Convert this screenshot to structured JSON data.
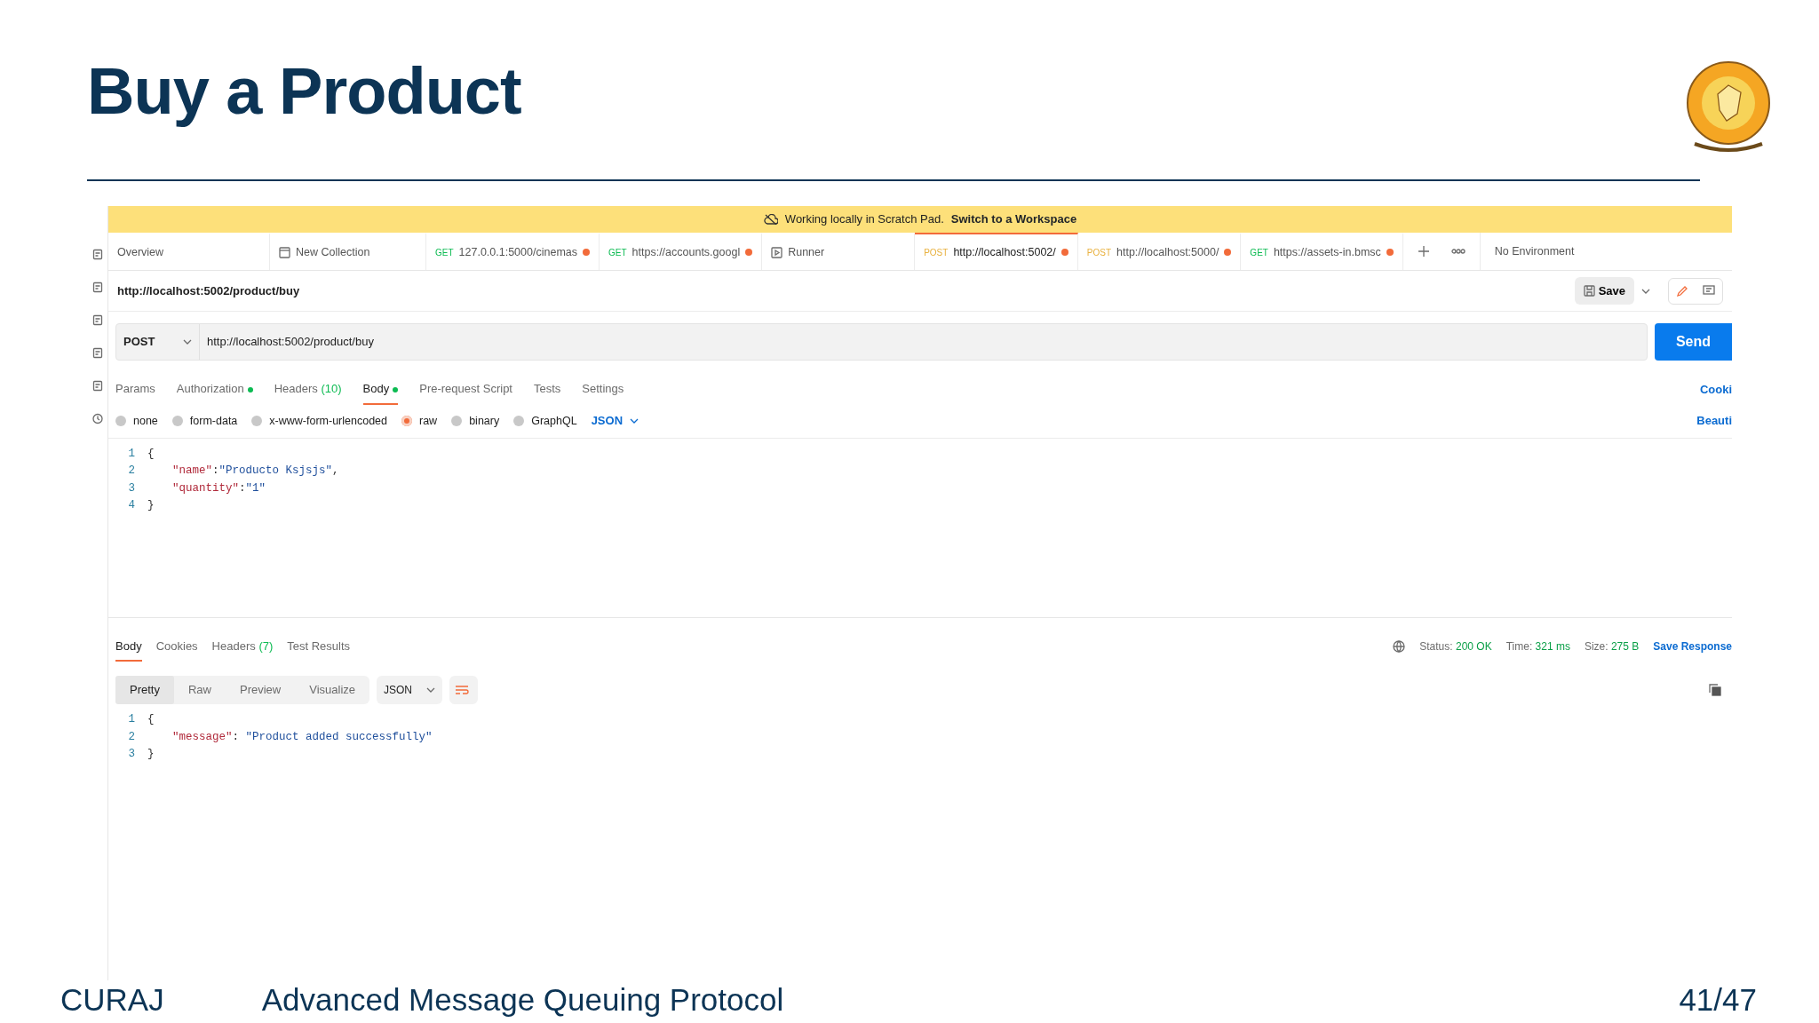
{
  "slide": {
    "title": "Buy a Product"
  },
  "banner": {
    "text": "Working locally in Scratch Pad.",
    "link": "Switch to a Workspace"
  },
  "tabs": [
    {
      "kind": "overview",
      "label": "Overview",
      "selected": false,
      "unsaved": false
    },
    {
      "kind": "collection",
      "label": "New Collection",
      "selected": false,
      "unsaved": false
    },
    {
      "kind": "request",
      "method": "GET",
      "label": "127.0.0.1:5000/cinemas",
      "selected": false,
      "unsaved": true
    },
    {
      "kind": "request",
      "method": "GET",
      "label": "https://accounts.googl",
      "selected": false,
      "unsaved": true
    },
    {
      "kind": "runner",
      "label": "Runner",
      "selected": false,
      "unsaved": false
    },
    {
      "kind": "request",
      "method": "POST",
      "label": "http://localhost:5002/",
      "selected": true,
      "unsaved": true
    },
    {
      "kind": "request",
      "method": "POST",
      "label": "http://localhost:5000/",
      "selected": false,
      "unsaved": true
    },
    {
      "kind": "request",
      "method": "GET",
      "label": "https://assets-in.bmsc",
      "selected": false,
      "unsaved": true
    }
  ],
  "environment": "No Environment",
  "request": {
    "name": "http://localhost:5002/product/buy",
    "save": "Save",
    "method": "POST",
    "url": "http://localhost:5002/product/buy",
    "send": "Send",
    "tabs": [
      {
        "label": "Params",
        "dot": false,
        "selected": false
      },
      {
        "label": "Authorization",
        "dot": true,
        "selected": false
      },
      {
        "label": "Headers",
        "count": "(10)",
        "dot": false,
        "selected": false
      },
      {
        "label": "Body",
        "dot": true,
        "selected": true
      },
      {
        "label": "Pre-request Script",
        "dot": false,
        "selected": false
      },
      {
        "label": "Tests",
        "dot": false,
        "selected": false
      },
      {
        "label": "Settings",
        "dot": false,
        "selected": false
      }
    ],
    "cookies_link": "Cooki",
    "body_types": [
      {
        "label": "none",
        "selected": false
      },
      {
        "label": "form-data",
        "selected": false
      },
      {
        "label": "x-www-form-urlencoded",
        "selected": false
      },
      {
        "label": "raw",
        "selected": true
      },
      {
        "label": "binary",
        "selected": false
      },
      {
        "label": "GraphQL",
        "selected": false
      }
    ],
    "format": "JSON",
    "beautify_link": "Beauti",
    "body_lines": [
      {
        "number": "1",
        "indent": false,
        "tokens": [
          {
            "kind": "punct",
            "text": "{"
          }
        ]
      },
      {
        "number": "2",
        "indent": true,
        "tokens": [
          {
            "kind": "key",
            "text": "\"name\""
          },
          {
            "kind": "punct",
            "text": ":"
          },
          {
            "kind": "string",
            "text": "\"Producto Ksjsjs\""
          },
          {
            "kind": "punct",
            "text": ","
          }
        ]
      },
      {
        "number": "3",
        "indent": true,
        "tokens": [
          {
            "kind": "key",
            "text": "\"quantity\""
          },
          {
            "kind": "punct",
            "text": ":"
          },
          {
            "kind": "string",
            "text": "\"1\""
          }
        ]
      },
      {
        "number": "4",
        "indent": false,
        "tokens": [
          {
            "kind": "punct",
            "text": "}"
          }
        ]
      }
    ]
  },
  "response": {
    "tabs": [
      {
        "label": "Body",
        "selected": true
      },
      {
        "label": "Cookies",
        "selected": false
      },
      {
        "label": "Headers",
        "count": "(7)",
        "selected": false
      },
      {
        "label": "Test Results",
        "selected": false
      }
    ],
    "stats": [
      {
        "label": "Status:",
        "value": "200 OK"
      },
      {
        "label": "Time:",
        "value": "321 ms"
      },
      {
        "label": "Size:",
        "value": "275 B"
      }
    ],
    "save_response": "Save Response",
    "views": [
      {
        "label": "Pretty",
        "selected": true
      },
      {
        "label": "Raw",
        "selected": false
      },
      {
        "label": "Preview",
        "selected": false
      },
      {
        "label": "Visualize",
        "selected": false
      }
    ],
    "format": "JSON",
    "body_lines": [
      {
        "number": "1",
        "indent": false,
        "tokens": [
          {
            "kind": "punct",
            "text": "{"
          }
        ]
      },
      {
        "number": "2",
        "indent": true,
        "tokens": [
          {
            "kind": "key",
            "text": "\"message\""
          },
          {
            "kind": "punct",
            "text": ": "
          },
          {
            "kind": "string",
            "text": "\"Product added successfully\""
          }
        ]
      },
      {
        "number": "3",
        "indent": false,
        "tokens": [
          {
            "kind": "punct",
            "text": "}"
          }
        ]
      }
    ]
  },
  "footer": {
    "left": "CURAJ",
    "center": "Advanced Message Queuing Protocol",
    "page": "41/47"
  }
}
